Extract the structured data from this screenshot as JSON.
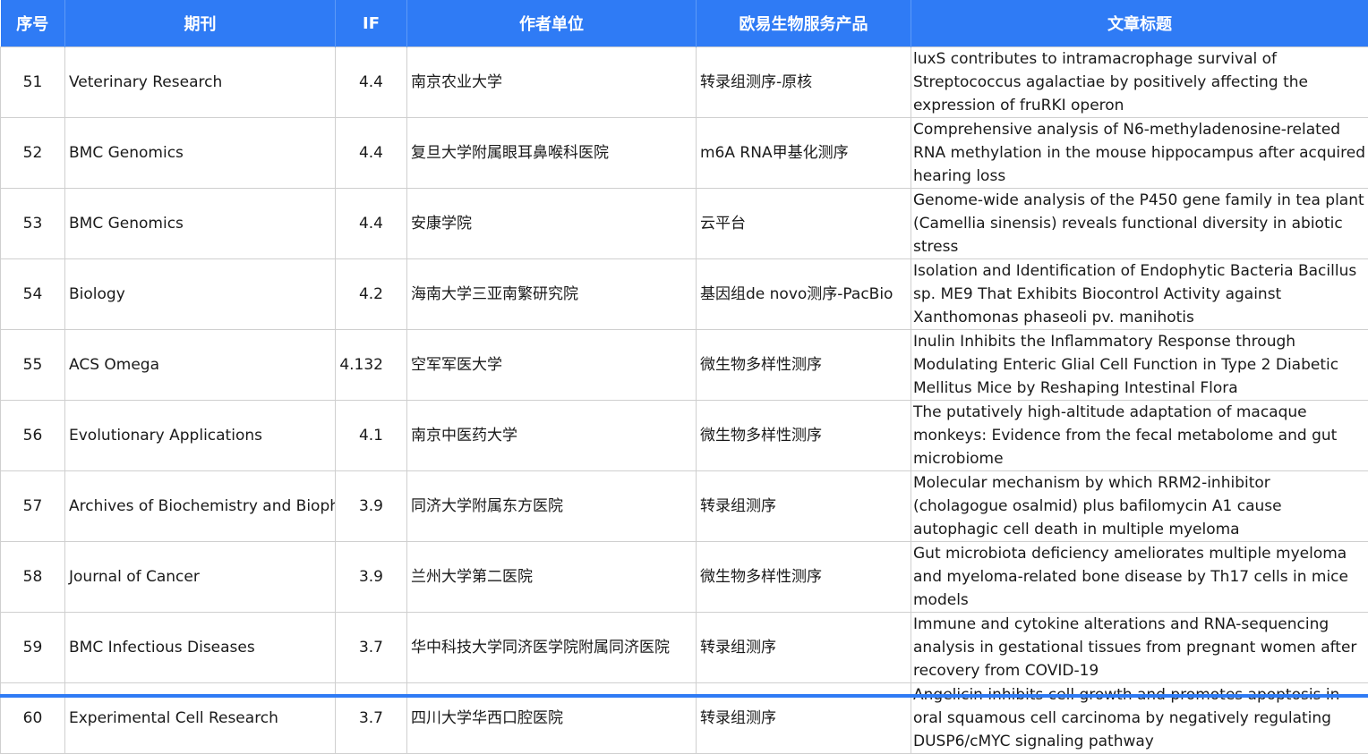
{
  "headers": {
    "index": "序号",
    "journal": "期刊",
    "if": "IF",
    "affiliation": "作者单位",
    "product": "欧易生物服务产品",
    "title": "文章标题"
  },
  "rows": [
    {
      "index": "51",
      "journal": "Veterinary Research",
      "if": "4.4",
      "affiliation": "南京农业大学",
      "product": "转录组测序-原核",
      "title": "luxS contributes to intramacrophage survival of Streptococcus agalactiae by positively affecting the expression of fruRKI operon"
    },
    {
      "index": "52",
      "journal": "BMC Genomics",
      "if": "4.4",
      "affiliation": "复旦大学附属眼耳鼻喉科医院",
      "product": "m6A RNA甲基化测序",
      "title": "Comprehensive analysis of N6-methyladenosine-related RNA methylation in the mouse hippocampus after acquired hearing loss"
    },
    {
      "index": "53",
      "journal": "BMC Genomics",
      "if": "4.4",
      "affiliation": "安康学院",
      "product": "云平台",
      "title": "Genome-wide analysis of the P450 gene family in tea plant (Camellia sinensis) reveals functional diversity in abiotic stress"
    },
    {
      "index": "54",
      "journal": "Biology",
      "if": "4.2",
      "affiliation": "海南大学三亚南繁研究院",
      "product": "基因组de novo测序-PacBio",
      "title": "Isolation and Identification of Endophytic Bacteria Bacillus sp. ME9 That Exhibits Biocontrol Activity against Xanthomonas phaseoli pv. manihotis"
    },
    {
      "index": "55",
      "journal": "ACS Omega",
      "if": "4.132",
      "affiliation": "空军军医大学",
      "product": "微生物多样性测序",
      "title": "Inulin Inhibits the Inflammatory Response through Modulating Enteric Glial Cell Function in Type 2 Diabetic Mellitus Mice by Reshaping Intestinal Flora"
    },
    {
      "index": "56",
      "journal": "Evolutionary Applications",
      "if": "4.1",
      "affiliation": "南京中医药大学",
      "product": "微生物多样性测序",
      "title": "The putatively high-altitude adaptation of macaque monkeys: Evidence from the fecal metabolome and gut microbiome"
    },
    {
      "index": "57",
      "journal": "Archives of Biochemistry and Biophy",
      "if": "3.9",
      "affiliation": "同济大学附属东方医院",
      "product": "转录组测序",
      "title": "Molecular mechanism by which RRM2-inhibitor (cholagogue osalmid) plus bafilomycin A1 cause autophagic cell death in multiple myeloma"
    },
    {
      "index": "58",
      "journal": "Journal of Cancer",
      "if": "3.9",
      "affiliation": "兰州大学第二医院",
      "product": "微生物多样性测序",
      "title": "Gut microbiota deficiency ameliorates multiple myeloma and myeloma-related bone disease by Th17 cells in mice models"
    },
    {
      "index": "59",
      "journal": "BMC Infectious Diseases",
      "if": "3.7",
      "affiliation": "华中科技大学同济医学院附属同济医院",
      "product": "转录组测序",
      "title": "Immune and cytokine alterations and RNA-sequencing analysis in gestational tissues from pregnant women after recovery from COVID-19"
    },
    {
      "index": "60",
      "journal": "Experimental Cell Research",
      "if": "3.7",
      "affiliation": "四川大学华西口腔医院",
      "product": "转录组测序",
      "title": "Angelicin inhibits cell growth and promotes apoptosis in oral squamous cell carcinoma by negatively regulating DUSP6/cMYC signaling pathway"
    }
  ],
  "colors": {
    "header_bg": "#2f7bf5",
    "header_text": "#ffffff",
    "grid": "#cfcfcf"
  }
}
